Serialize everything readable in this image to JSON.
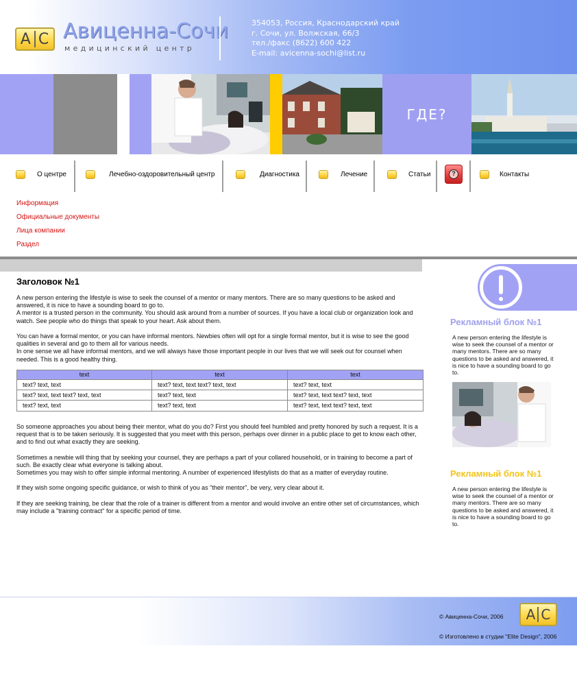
{
  "header": {
    "logo_left": "A",
    "logo_right": "C",
    "brand_name": "Авиценна-Сочи",
    "brand_subtitle": "медицинский центр",
    "address_lines": [
      "354053, Россия, Краснодарский край",
      "г. Сочи, ул. Волжская, 66/3",
      "тел./факс (8622) 600 422",
      "E-mail: avicenna-sochi@list.ru"
    ]
  },
  "banner": {
    "where_text": "ГДЕ?"
  },
  "nav": {
    "items": [
      {
        "label": "О центре"
      },
      {
        "label": "Лечебно-оздоровительный центр"
      },
      {
        "label": "Диагностика"
      },
      {
        "label": "Лечение"
      },
      {
        "label": "Статьи"
      },
      {
        "label": "Контакты"
      }
    ],
    "help_icon": "question-icon"
  },
  "submenu": {
    "items": [
      "Информация",
      "Официальные документы",
      "Лица компании",
      "Раздел"
    ],
    "color": "#d41212"
  },
  "main": {
    "title": "Заголовок №1",
    "paragraphs_top": [
      "A new person entering the lifestyle is wise to seek the counsel of a mentor or many mentors. There are so many questions to be asked and answered, it is nice to have a sounding board to go to.",
      "A mentor is a trusted person in the community. You should ask around from a number of sources. If you have a local club or organization look and watch. See people who do things that speak to your heart. Ask about them.",
      "",
      "You can have a formal mentor, or you can have informal mentors. Newbies often will opt for a single formal mentor, but it is wise to see the good qualities in several and go to them all for various needs.",
      "In one sense we all have informal mentors, and we will always have those important people in our lives that we will seek out for counsel when needed. This is a good healthy thing."
    ],
    "table": {
      "headers": [
        "text",
        "text",
        "text"
      ],
      "rows": [
        [
          "text? text, text",
          "text? text, text text? text, text",
          "text? text, text"
        ],
        [
          "text? text, text  text? text, text",
          "text? text, text",
          "text? text, text text? text, text"
        ],
        [
          "text? text, text",
          "text? text, text",
          "text? text, text text? text, text"
        ]
      ]
    },
    "paragraphs_bottom": [
      "So someone approaches you about being their mentor, what do you do? First you should feel humbled and pretty honored by such a request. It is a request that is to be taken seriously.  It is suggested that you meet with this person, perhaps over dinner in a public place to get to know each other, and to find out what exactly they are seeking.",
      "",
      "Sometimes a newbie will thing that by seeking your counsel, they are perhaps a part of your collared household, or in training to become a part of such. Be exactly clear what everyone is talking about.",
      "Sometimes you may wish to offer simple informal mentoring. A number of experienced lifestylists do that as a matter of everyday routine.",
      "",
      "If they wish some ongoing specific guidance, or wish to think of you as \"their mentor\", be very, very clear about it.",
      "",
      "If they are seeking training, be clear that the role of a trainer is different from a mentor and would involve an entire other set of circumstances, which may include a \"training contract\" for a specific period of time."
    ]
  },
  "sidebar": {
    "icon": "exclamation-icon",
    "ads": [
      {
        "title": "Рекламный блок №1",
        "title_color": "#a0a0ef",
        "text": "A new person entering the lifestyle is wise to seek the counsel of a mentor or many mentors. There are so many questions to be asked and answered, it is nice to have a sounding board to go to."
      },
      {
        "title": "Рекламный блок №1",
        "title_color": "#f2c418",
        "text": "A new person entering the lifestyle is wise to seek the counsel of a mentor or many mentors. There are so many questions to be asked and answered, it is nice to have a sounding board to go to."
      }
    ]
  },
  "footer": {
    "copyright": "©  Авиценна-Сочи, 2006",
    "made_by": "©  Изготовлено в студии \"Elite Design\", 2006",
    "logo_left": "A",
    "logo_right": "C"
  },
  "colors": {
    "accent_purple": "#a2a2f5",
    "accent_yellow": "#ffcc00",
    "link_red": "#d41212",
    "header_blue": "#6f91ee"
  }
}
